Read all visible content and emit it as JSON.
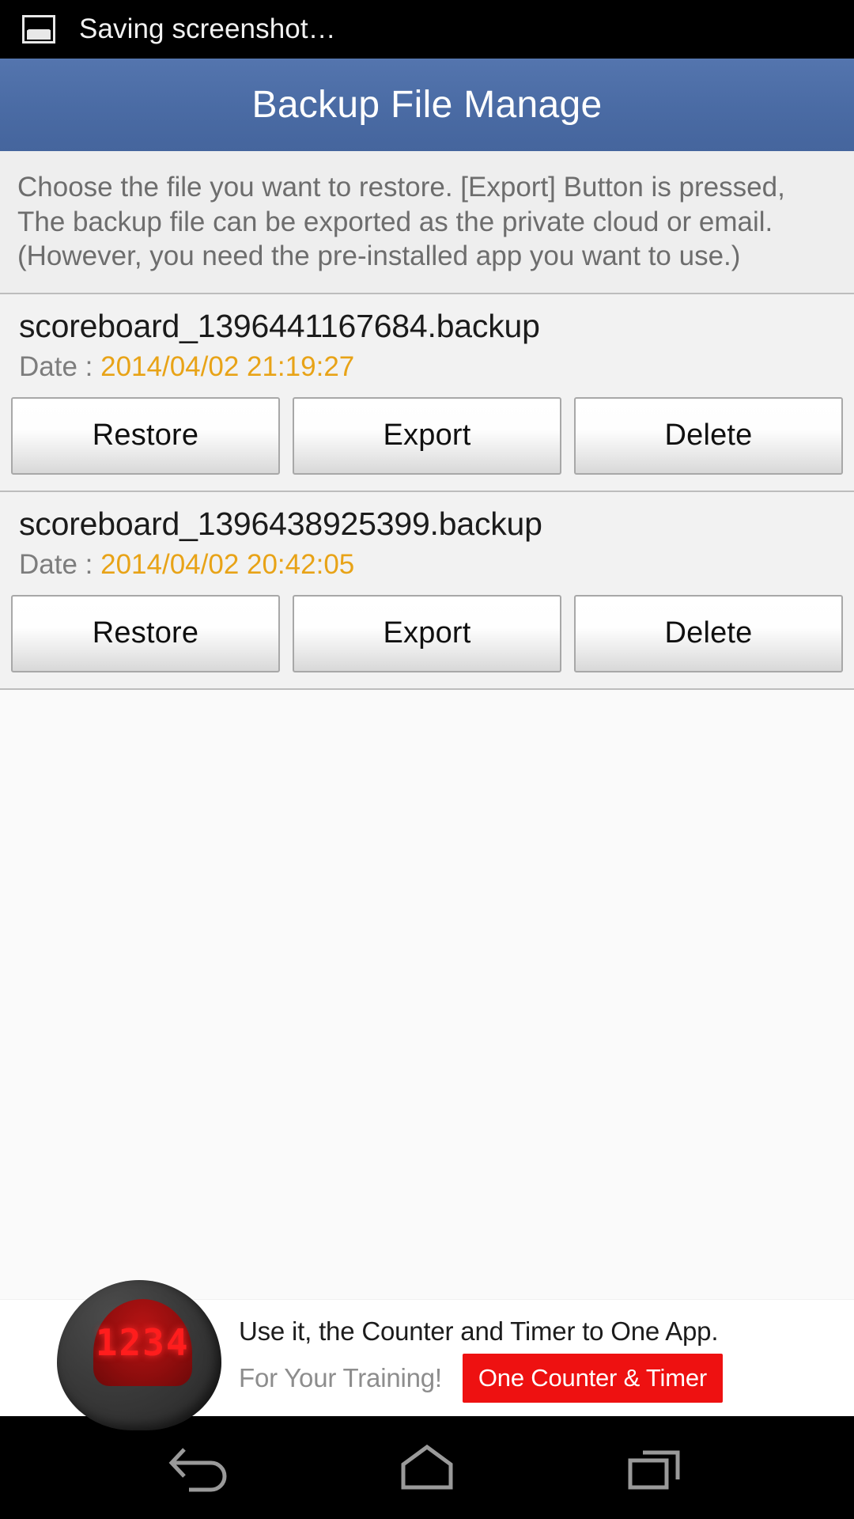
{
  "statusbar": {
    "icon": "image-screenshot-icon",
    "text": "Saving screenshot…"
  },
  "titlebar": {
    "title": "Backup File Manage",
    "color": "#4a6ba4"
  },
  "intro": {
    "line1": "Choose the file you want to restore.",
    "line2": "[Export] Button is pressed, The backup file can be exported as the private cloud or email.",
    "line3": "(However, you need the pre-installed app you want to use.)",
    "text": "Choose the file you want to restore.\n[Export] Button is pressed, The backup file can be exported as the private cloud or email.\n(However, you need the pre-installed app you want to use.)"
  },
  "list": {
    "date_label": "Date : ",
    "date_color": "#e8a317",
    "buttons": {
      "restore": "Restore",
      "export": "Export",
      "delete": "Delete"
    },
    "items": [
      {
        "filename": "scoreboard_1396441167684.backup",
        "date": "2014/04/02 21:19:27"
      },
      {
        "filename": "scoreboard_1396438925399.backup",
        "date": "2014/04/02 20:42:05"
      }
    ]
  },
  "ad": {
    "logo_digits": "1234",
    "headline": "Use it, the Counter and Timer to One App.",
    "subline": "For Your Training!",
    "cta": "One Counter & Timer",
    "cta_color": "#ee1111"
  },
  "navbar": {
    "back": "back-icon",
    "home": "home-icon",
    "recents": "recents-icon"
  }
}
